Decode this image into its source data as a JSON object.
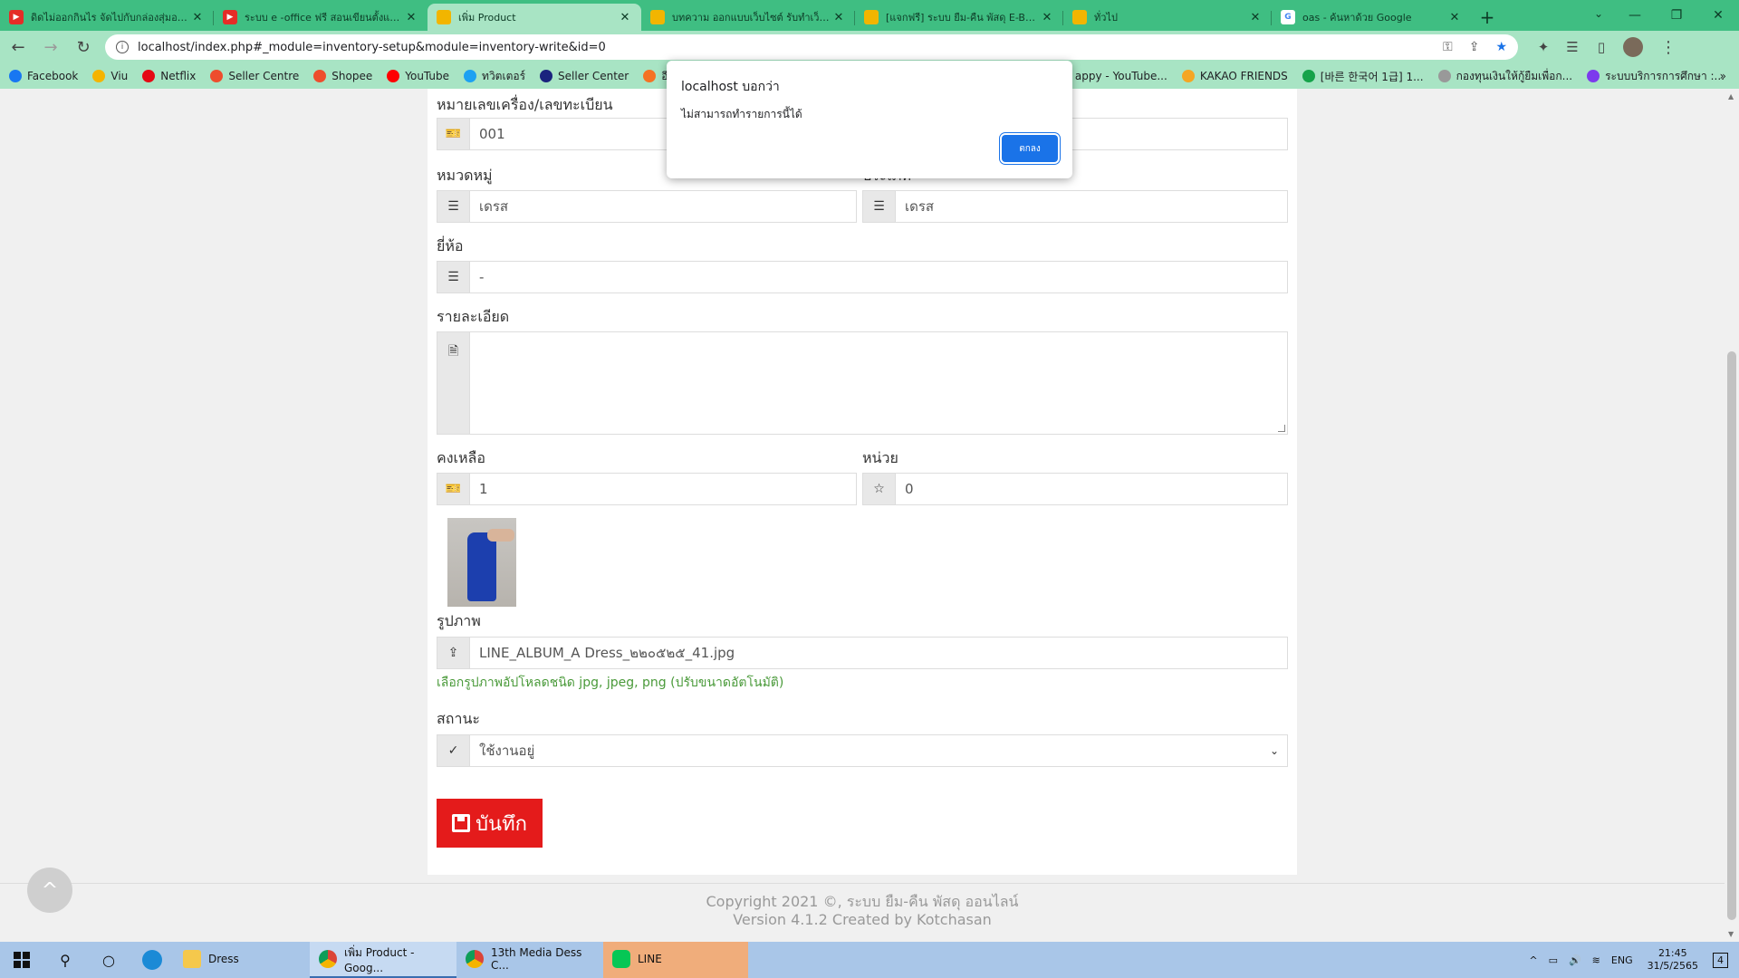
{
  "browser": {
    "tabs": [
      {
        "title": "ดิดไม่ออกกินไร จัดไปกับกล่องสุ่มอาหาร",
        "icon": "youtube",
        "active": false
      },
      {
        "title": "ระบบ e -office ฟรี สอนเขียนตั้งแบบง่าย",
        "icon": "youtube",
        "active": false
      },
      {
        "title": "เพิ่ม Product",
        "icon": "site",
        "active": true
      },
      {
        "title": "บทความ ออกแบบเว็บไซต์ รับทำเว็บไซต์",
        "icon": "site",
        "active": false
      },
      {
        "title": "[แจกฟรี] ระบบ ยืม-คืน พัสดุ E-Borrow",
        "icon": "site",
        "active": false
      },
      {
        "title": "ทั่วไป",
        "icon": "site",
        "active": false
      },
      {
        "title": "oas - ค้นหาด้วย Google",
        "icon": "google",
        "active": false
      }
    ],
    "url": "localhost/index.php#_module=inventory-setup&module=inventory-write&id=0",
    "bookmarks": [
      {
        "label": "Facebook",
        "color": "#1877f2"
      },
      {
        "label": "Viu",
        "color": "#f5b400"
      },
      {
        "label": "Netflix",
        "color": "#e50914"
      },
      {
        "label": "Seller Centre",
        "color": "#ee4d2d"
      },
      {
        "label": "Shopee",
        "color": "#ee4d2d"
      },
      {
        "label": "YouTube",
        "color": "#ff0000"
      },
      {
        "label": "ทวิตเตอร์",
        "color": "#1da1f2"
      },
      {
        "label": "Seller Center",
        "color": "#1a237e"
      },
      {
        "label": "อี",
        "color": "#f57224"
      },
      {
        "label": "appy - YouTube...",
        "color": "#ff0000"
      },
      {
        "label": "KAKAO FRIENDS",
        "color": "#f5a623"
      },
      {
        "label": "[바른 한국어 1급] 1...",
        "color": "#16a34a"
      },
      {
        "label": "กองทุนเงินให้กู้ยืมเพื่อก...",
        "color": "#999999"
      },
      {
        "label": "ระบบบริการการศึกษา :...",
        "color": "#7c3aed"
      }
    ]
  },
  "form": {
    "machine_label": "หมายเลขเครื่อง/เลขทะเบียน",
    "machine_value": "001",
    "category_label": "หมวดหมู่",
    "type_label": "ประเภท",
    "category_value": "เดรส",
    "type_value": "เดรส",
    "brand_label": "ยี่ห้อ",
    "brand_value": "-",
    "detail_label": "รายละเอียด",
    "detail_value": "",
    "stock_label": "คงเหลือ",
    "stock_value": "1",
    "unit_label": "หน่วย",
    "unit_value": "0",
    "image_label": "รูปภาพ",
    "image_file": "LINE_ALBUM_A Dress_๒๒๐๕๒๕_41.jpg",
    "image_hint": "เลือกรูปภาพอัปโหลดชนิด jpg, jpeg, png (ปรับขนาดอัตโนมัติ)",
    "status_label": "สถานะ",
    "status_value": "ใช้งานอยู่",
    "save_label": "บันทึก"
  },
  "footer": {
    "copyright": "Copyright 2021 ©, ระบบ ยืม-คืน พัสดุ ออนไลน์",
    "version": "Version 4.1.2 Created by Kotchasan"
  },
  "dialog": {
    "title": "localhost บอกว่า",
    "message": "ไม่สามารถทำรายการนี้ได้",
    "ok_label": "ตกลง"
  },
  "taskbar": {
    "apps": [
      {
        "label": "Dress",
        "icon": "folder"
      },
      {
        "label": "เพิ่ม Product - Goog...",
        "icon": "chrome"
      },
      {
        "label": "13th Media Dess C...",
        "icon": "chrome"
      },
      {
        "label": "LINE",
        "icon": "line"
      }
    ],
    "lang": "ENG",
    "time": "21:45",
    "date": "31/5/2565",
    "notifications": "4"
  }
}
